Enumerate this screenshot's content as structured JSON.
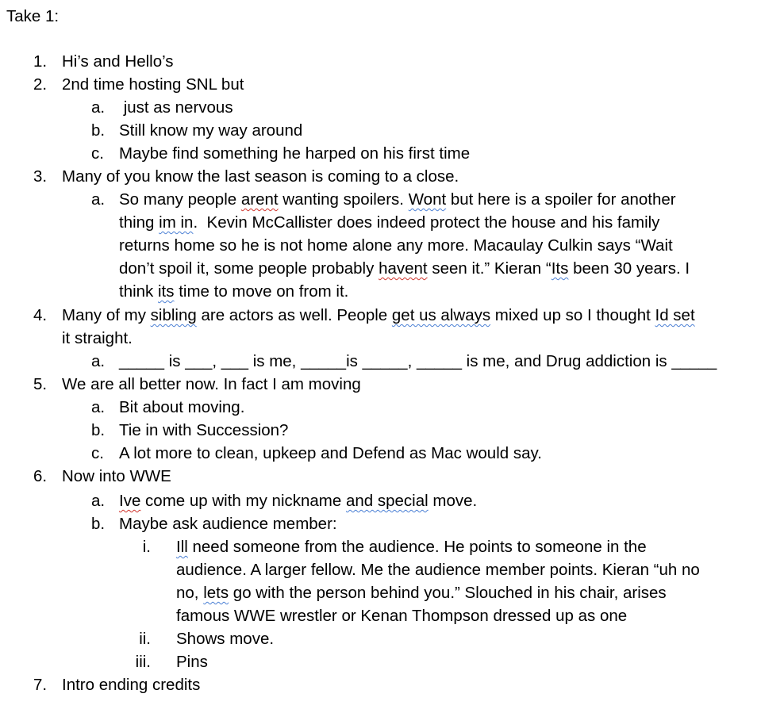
{
  "document": {
    "title": "Take 1:",
    "markers": {
      "n1": "1.",
      "n2": "2.",
      "n3": "3.",
      "n4": "4.",
      "n5": "5.",
      "n6": "6.",
      "n7": "7.",
      "a": "a.",
      "b": "b.",
      "c": "c.",
      "i": "i.",
      "ii": "ii.",
      "iii": "iii."
    },
    "items": {
      "i1": "Hi’s and Hello’s",
      "i2": "2nd time hosting SNL but",
      "i2a": " just as nervous",
      "i2b": "Still know my way around",
      "i2c": "Maybe find something he harped on his first time",
      "i3": "Many of you know the last season is coming to a close.",
      "i3a": {
        "l1a": "So many people ",
        "l1_err1": "arent",
        "l1b": " wanting spoilers. ",
        "l1_err2": "Wont",
        "l1c": " but here is a spoiler for another",
        "l2a": "thing ",
        "l2_err": "im in",
        "l2b": ".  Kevin McCallister does indeed protect the house and his family",
        "l3": "returns home so he is not home alone any more. Macaulay Culkin says “Wait",
        "l4a": "don’t spoil it, some people probably ",
        "l4_err1": "havent",
        "l4b": " seen it.” Kieran “",
        "l4_err2": "Its",
        "l4c": " been 30 years. I",
        "l5a": "think ",
        "l5_err": "its",
        "l5b": " time to move on from it."
      },
      "i4": {
        "l1a": "Many of my ",
        "l1_err1": "sibling",
        "l1b": " are actors as well. People ",
        "l1_err2": "get us always",
        "l1c": " mixed up so I thought ",
        "l1_err3": "Id set",
        "l2": "it straight."
      },
      "i4a": "_____ is ___, ___ is me, _____is _____, _____ is me, and Drug addiction is _____",
      "i5": "We are all better now. In fact I am moving",
      "i5a": "Bit about moving.",
      "i5b": "Tie in with Succession?",
      "i5c": "A lot more to clean, upkeep and Defend as Mac would say.",
      "i6": "Now into WWE",
      "i6a": {
        "err1": "Ive",
        "b": " come up with my nickname ",
        "err2": "and special",
        "c": " move."
      },
      "i6b": "Maybe ask audience member:",
      "i6bi": {
        "l1_err": "Ill",
        "l1b": " need someone from the audience. He points to someone in the",
        "l2": "audience. A larger fellow. Me the audience member points. Kieran “uh no",
        "l3a": "no, ",
        "l3_err": "lets",
        "l3b": " go with the person behind you.” Slouched in his chair, arises",
        "l4": "famous WWE wrestler or Kenan Thompson dressed up as one"
      },
      "i6bii": "Shows move.",
      "i6biii": "Pins",
      "i7": "Intro ending credits"
    }
  }
}
